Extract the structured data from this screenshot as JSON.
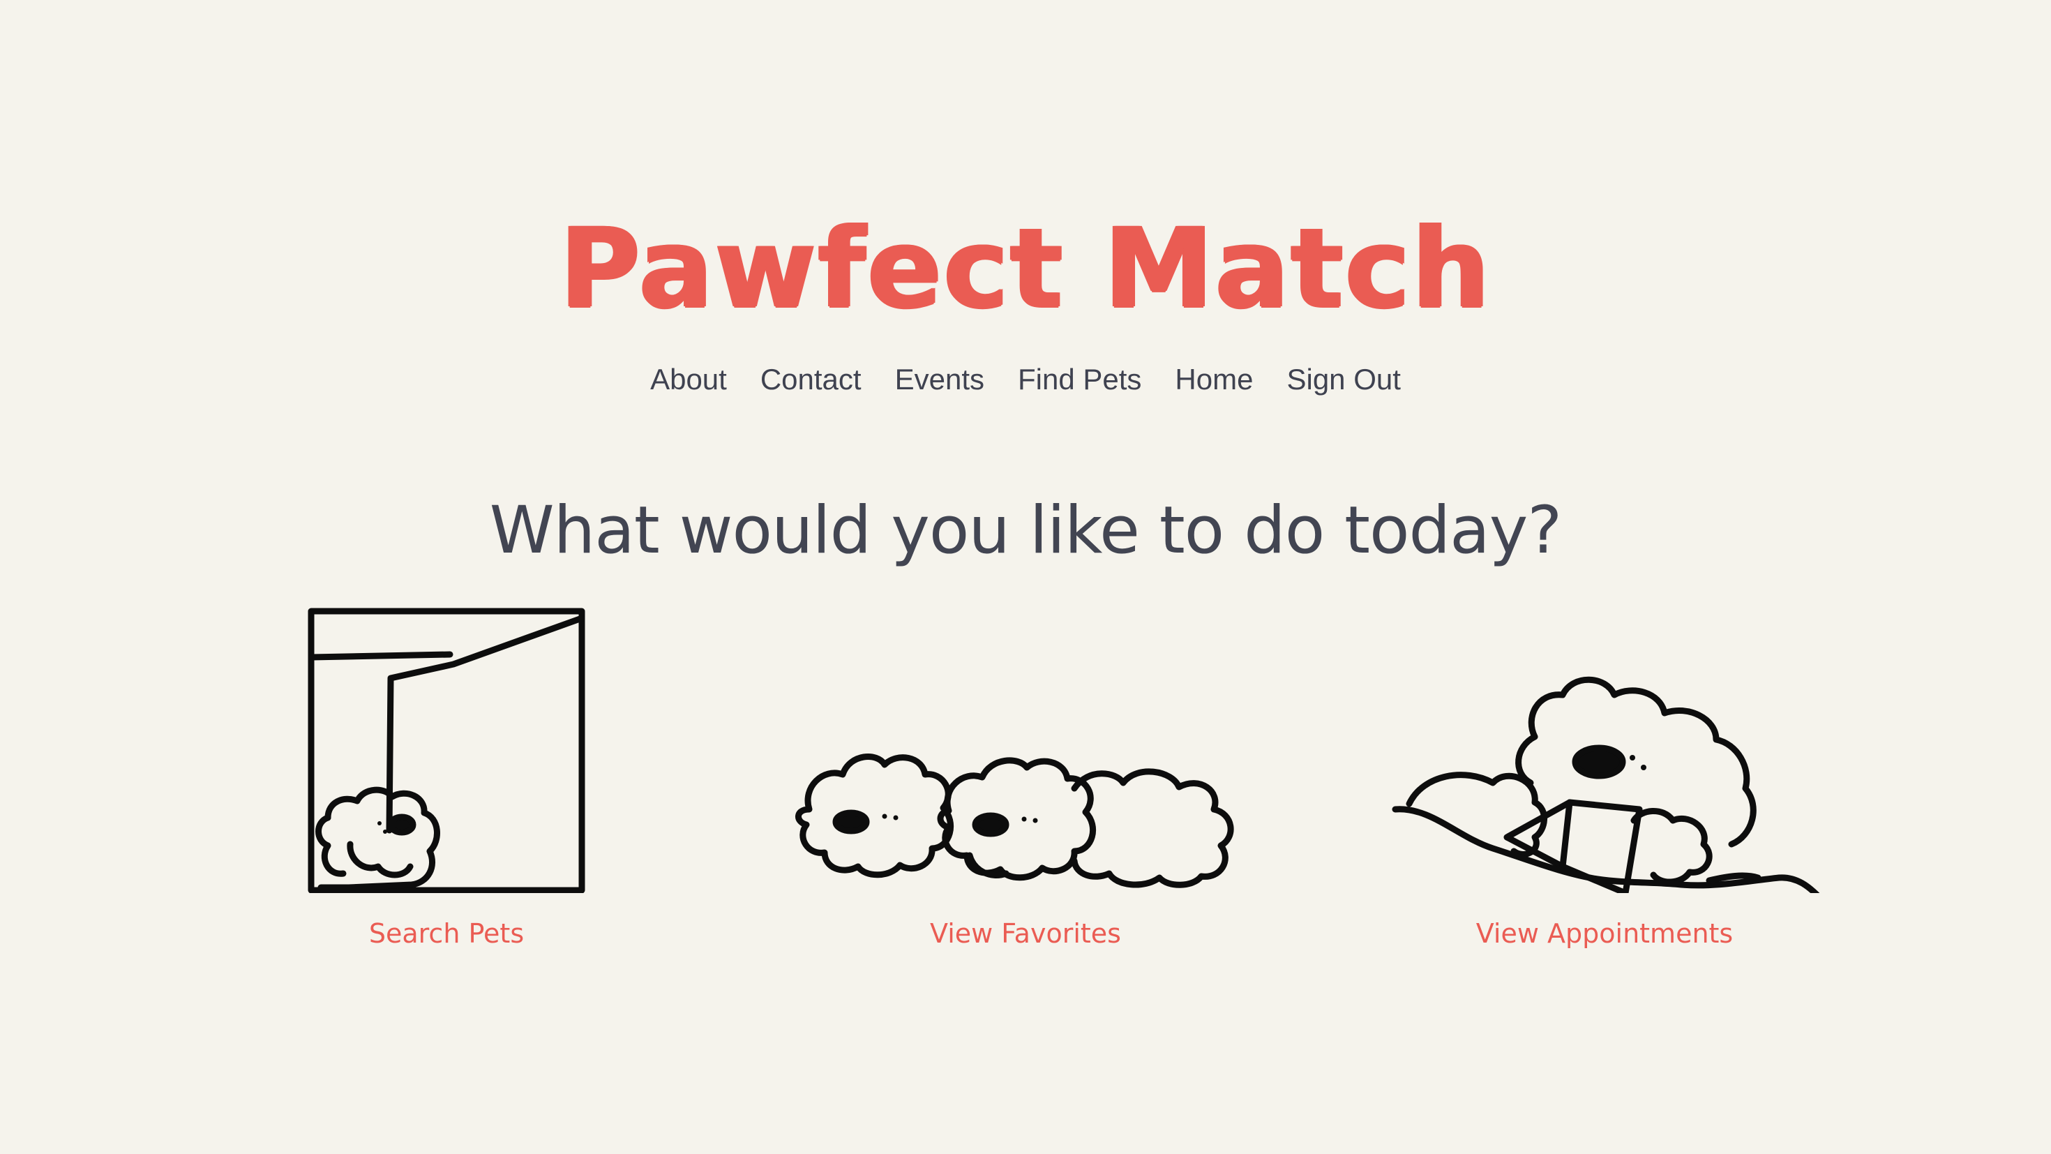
{
  "brand": {
    "title": "Pawfect Match",
    "color": "#ea5c53"
  },
  "nav": {
    "items": [
      {
        "label": "About"
      },
      {
        "label": "Contact"
      },
      {
        "label": "Events"
      },
      {
        "label": "Find Pets"
      },
      {
        "label": "Home"
      },
      {
        "label": "Sign Out"
      }
    ]
  },
  "main": {
    "headline": "What would you like to do today?",
    "actions": [
      {
        "label": "Search Pets",
        "icon": "dog-peeking-window-icon"
      },
      {
        "label": "View Favorites",
        "icon": "two-dogs-lying-icon"
      },
      {
        "label": "View Appointments",
        "icon": "dog-reading-book-icon"
      }
    ]
  },
  "colors": {
    "background": "#f5f3ec",
    "text": "#3f4250",
    "accent": "#ea5c53"
  }
}
